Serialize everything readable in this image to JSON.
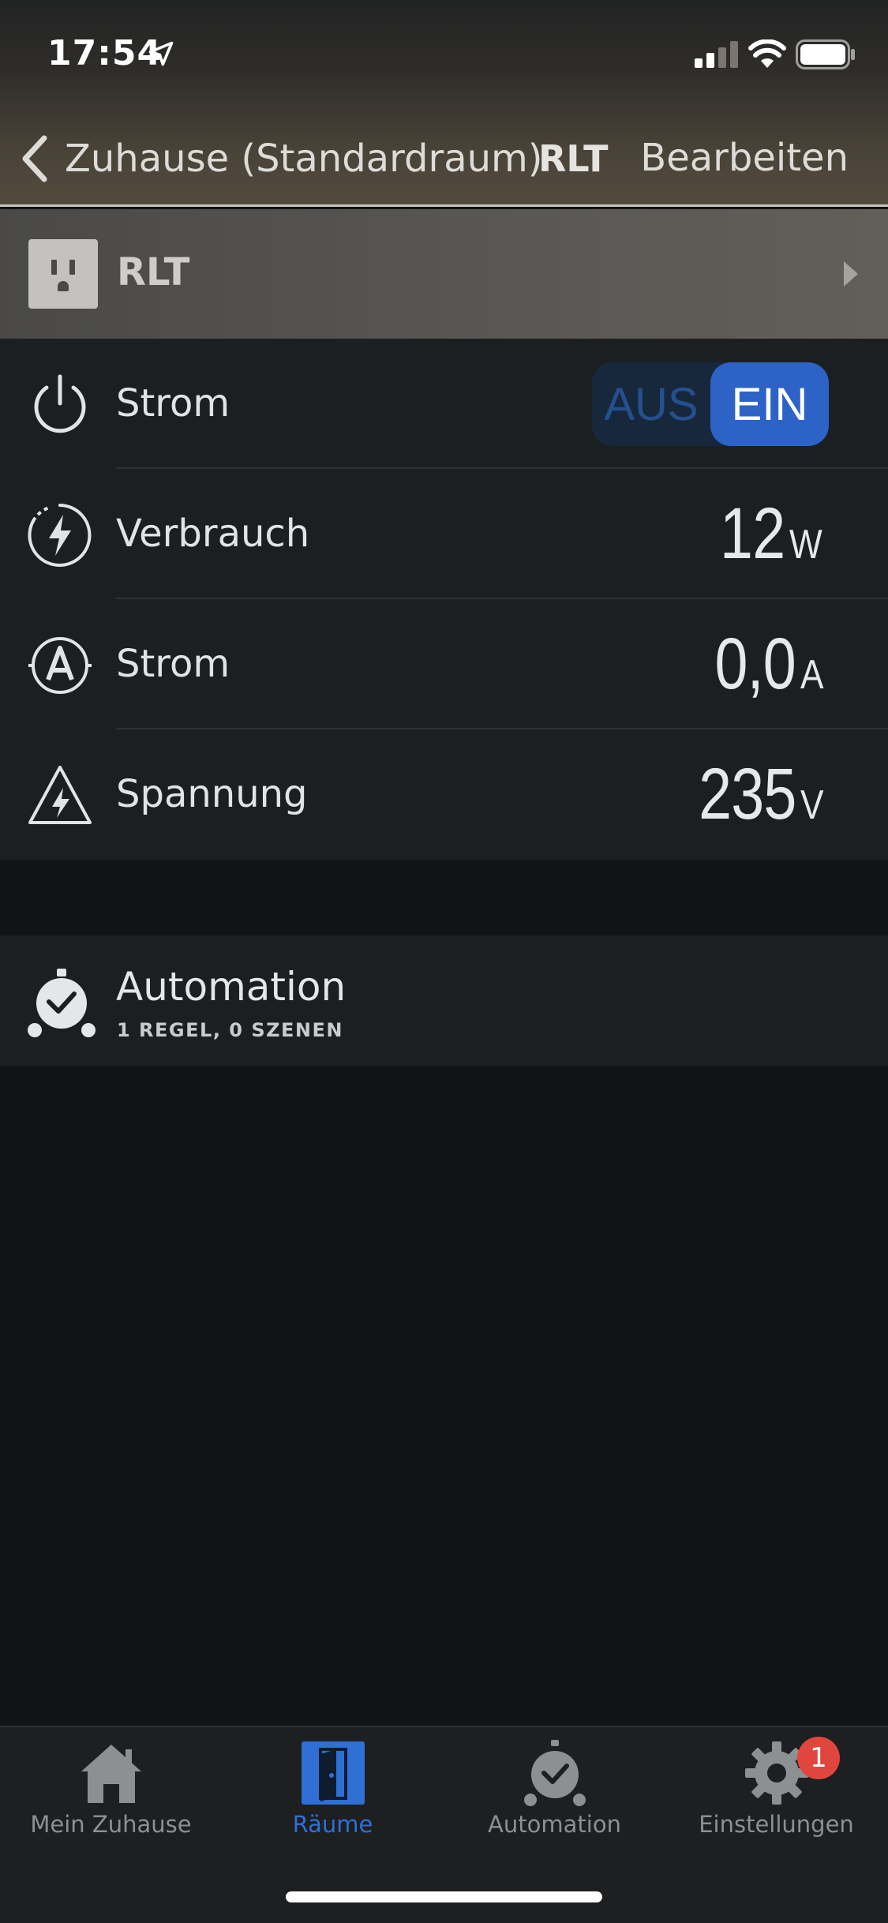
{
  "status_bar": {
    "time": "17:54"
  },
  "nav": {
    "back_label": "Zuhause (Standardraum)",
    "title": "RLT",
    "edit_label": "Bearbeiten"
  },
  "device": {
    "name": "RLT",
    "icon": "outlet-icon"
  },
  "attributes": {
    "power": {
      "label": "Strom",
      "off_label": "AUS",
      "on_label": "EIN",
      "state": "EIN"
    },
    "consumption": {
      "label": "Verbrauch",
      "value": "12",
      "unit": "W"
    },
    "current": {
      "label": "Strom",
      "value": "0,0",
      "unit": "A"
    },
    "voltage": {
      "label": "Spannung",
      "value": "235",
      "unit": "V"
    }
  },
  "automation": {
    "title": "Automation",
    "subtitle": "1 REGEL, 0 SZENEN"
  },
  "tabs": [
    {
      "label": "Mein Zuhause",
      "icon": "home-icon",
      "active": false
    },
    {
      "label": "Räume",
      "icon": "door-icon",
      "active": true
    },
    {
      "label": "Automation",
      "icon": "alarm-clock-icon",
      "active": false
    },
    {
      "label": "Einstellungen",
      "icon": "gear-icon",
      "active": false,
      "badge": "1"
    }
  ],
  "colors": {
    "accent": "#2d63c6",
    "toggle_track": "#17283d",
    "badge": "#e0453e",
    "list_bg": "#1c1f22",
    "page_bg": "#111314"
  }
}
